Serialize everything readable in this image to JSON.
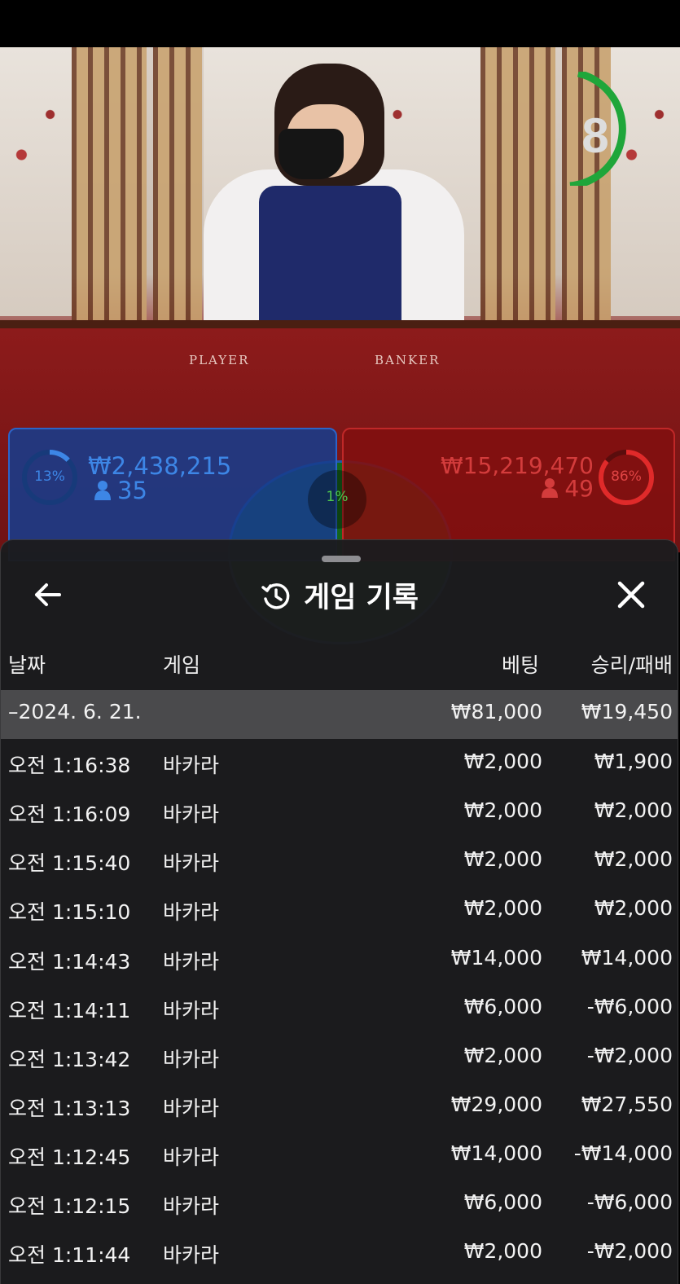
{
  "video": {
    "timer": "8",
    "felt_player": "PLAYER",
    "felt_banker": "BANKER",
    "player": {
      "percent": "13%",
      "amount": "₩2,438,215",
      "count": "35",
      "pct_value": 0.13
    },
    "banker": {
      "percent": "86%",
      "amount": "₩15,219,470",
      "count": "49",
      "pct_value": 0.86
    },
    "tie": {
      "percent": "1%"
    }
  },
  "sheet": {
    "title": "게임 기록",
    "columns": {
      "date": "날짜",
      "game": "게임",
      "bet": "베팅",
      "result": "승리/패배"
    },
    "day": {
      "date": "–2024. 6. 21.",
      "bet": "₩81,000",
      "result": "₩19,450"
    },
    "rows": [
      {
        "time": "오전 1:16:38",
        "game": "바카라",
        "bet": "₩2,000",
        "result": "₩1,900"
      },
      {
        "time": "오전 1:16:09",
        "game": "바카라",
        "bet": "₩2,000",
        "result": "₩2,000"
      },
      {
        "time": "오전 1:15:40",
        "game": "바카라",
        "bet": "₩2,000",
        "result": "₩2,000"
      },
      {
        "time": "오전 1:15:10",
        "game": "바카라",
        "bet": "₩2,000",
        "result": "₩2,000"
      },
      {
        "time": "오전 1:14:43",
        "game": "바카라",
        "bet": "₩14,000",
        "result": "₩14,000"
      },
      {
        "time": "오전 1:14:11",
        "game": "바카라",
        "bet": "₩6,000",
        "result": "-₩6,000"
      },
      {
        "time": "오전 1:13:42",
        "game": "바카라",
        "bet": "₩2,000",
        "result": "-₩2,000"
      },
      {
        "time": "오전 1:13:13",
        "game": "바카라",
        "bet": "₩29,000",
        "result": "₩27,550"
      },
      {
        "time": "오전 1:12:45",
        "game": "바카라",
        "bet": "₩14,000",
        "result": "-₩14,000"
      },
      {
        "time": "오전 1:12:15",
        "game": "바카라",
        "bet": "₩6,000",
        "result": "-₩6,000"
      },
      {
        "time": "오전 1:11:44",
        "game": "바카라",
        "bet": "₩2,000",
        "result": "-₩2,000"
      }
    ]
  },
  "icons": {
    "back": "arrow-left-icon",
    "history": "history-icon",
    "close": "close-icon",
    "person": "person-icon"
  },
  "colors": {
    "player_blue": "#3d86e6",
    "banker_red": "#d33c3c",
    "tie_green": "#4ec84e",
    "timer_green": "#1fa63a",
    "sheet_bg": "#1c1c1e",
    "day_row_bg": "#4a4a4c"
  }
}
